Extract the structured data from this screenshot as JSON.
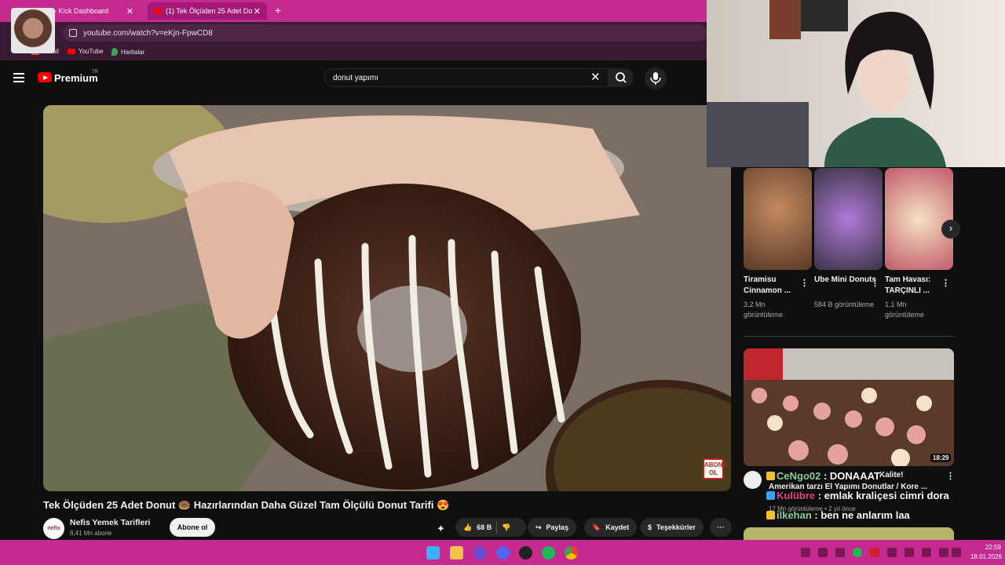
{
  "browser": {
    "tabs": [
      {
        "label": "Badges - Kick Dashboard",
        "active": false
      },
      {
        "label": "(1) Tek Ölçüden 25 Adet Do",
        "active": true
      }
    ],
    "url": "youtube.com/watch?v=eKjn-FpwCD8",
    "bookmarks": [
      "Gmail",
      "YouTube",
      "Haritalar"
    ]
  },
  "youtube": {
    "brand": "Premium",
    "region": "TR",
    "search_value": "donut yapımı",
    "video": {
      "title": "Tek Ölçüden 25 Adet Donut 🍩 Hazırlarından Daha Güzel Tam Ölçülü Donut Tarifi 😍",
      "watermark": "ABONE OL",
      "channel": "Nefis Yemek Tarifleri",
      "channel_avatar_text": "nefis",
      "subscribers": "6,41 Mn abone",
      "subscribe_label": "Abone ol",
      "likes": "68 B",
      "share_label": "Paylaş",
      "save_label": "Kaydet",
      "thanks_label": "Teşekkürler",
      "more_label": "···"
    },
    "shorts": [
      {
        "title": "Tiramisu Cinnamon ...",
        "views": "3,2 Mn görüntüleme",
        "color": "#8a5a3a"
      },
      {
        "title": "Ube Mini Donuts",
        "views": "584 B görüntüleme",
        "color": "#7a4fb0"
      },
      {
        "title": "Tam Havası: TARÇINLI ...",
        "views": "1,1 Mn görüntüleme",
        "color": "#d8b894"
      }
    ],
    "recommended": {
      "duration": "18:29",
      "title_tail": "Kalite!",
      "title_line2": "Amerikan tarzı El Yapımı Donutlar / Kore ...",
      "meta": "17 Mn görüntüleme • 2 yıl önce"
    }
  },
  "chat": [
    {
      "user": "CeNgo02",
      "message": "DONAAAT"
    },
    {
      "user": "Kulübre",
      "message": "emlak kraliçesi cimri dora"
    },
    {
      "user": "ilkehan",
      "message": "ben ne anlarım laa"
    }
  ],
  "taskbar": {
    "time": "22:59",
    "date": "18.01.2026",
    "apps": [
      "windows-start",
      "file-explorer",
      "app-purple",
      "discord",
      "obs",
      "spotify",
      "chrome"
    ]
  },
  "colors": {
    "chrome_accent": "#c52a8f",
    "youtube_red": "#ff0000",
    "chat_user": "#8bd3a0"
  }
}
